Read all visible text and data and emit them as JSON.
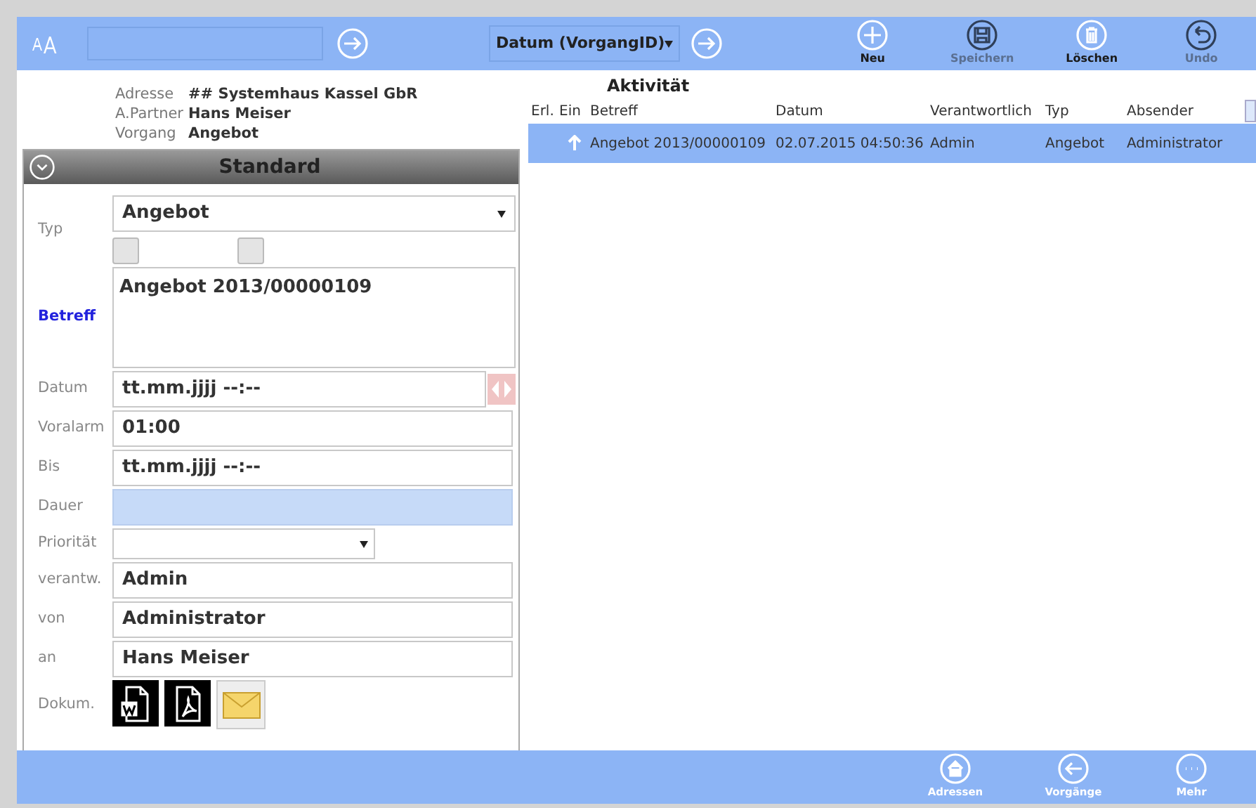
{
  "toolbar": {
    "sort_select": {
      "value": "Datum (VorgangID)"
    },
    "buttons": [
      {
        "label": "Neu",
        "disabled": false
      },
      {
        "label": "Speichern",
        "disabled": true
      },
      {
        "label": "Löschen",
        "disabled": false
      },
      {
        "label": "Undo",
        "disabled": true
      }
    ]
  },
  "header": [
    {
      "label": "Adresse",
      "value": "## Systemhaus Kassel GbR"
    },
    {
      "label": "A.Partner",
      "value": "Hans Meiser"
    },
    {
      "label": "Vorgang",
      "value": "Angebot"
    }
  ],
  "panel": {
    "title": "Standard",
    "fields": [
      {
        "kind": "select",
        "label": "Typ",
        "value": "Angebot",
        "checkboxes": [
          {
            "checked": false
          },
          {
            "checked": false
          }
        ]
      },
      {
        "kind": "textarea",
        "label": "Betreff",
        "value": "Angebot 2013/00000109",
        "highlight": true
      },
      {
        "kind": "date",
        "label": "Datum",
        "value": "tt.mm.jjjj --:--"
      },
      {
        "kind": "input",
        "label": "Voralarm",
        "value": "01:00"
      },
      {
        "kind": "input",
        "label": "Bis",
        "value": "tt.mm.jjjj --:--"
      },
      {
        "kind": "computed",
        "label": "Dauer"
      },
      {
        "kind": "select_short",
        "label": "Priorität"
      },
      {
        "kind": "input",
        "label": "verantw.",
        "value": "Admin"
      },
      {
        "kind": "input",
        "label": "von",
        "value": "Administrator"
      },
      {
        "kind": "input",
        "label": "an",
        "value": "Hans Meiser"
      },
      {
        "kind": "docs",
        "label": "Dokum."
      }
    ]
  },
  "activity": {
    "title": "Aktivität",
    "columns": [
      "Erl.",
      "Ein",
      "Betreff",
      "Datum",
      "Verantwortlich",
      "Typ",
      "Absender"
    ],
    "rows": [
      {
        "selected": true,
        "incoming": true,
        "cells": [
          "",
          "",
          "Angebot 2013/00000109",
          "02.07.2015 04:50:36",
          "Admin",
          "Angebot",
          "Administrator"
        ]
      }
    ]
  },
  "bottom_bar": [
    {
      "label": "Adressen"
    },
    {
      "label": "Vorgänge"
    },
    {
      "label": "Mehr"
    }
  ]
}
